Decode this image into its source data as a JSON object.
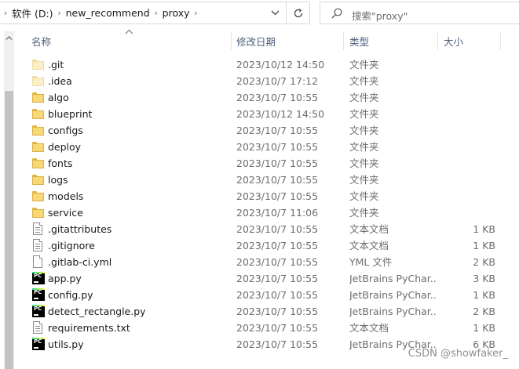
{
  "address_bar": {
    "breadcrumbs": [
      "软件 (D:)",
      "new_recommend",
      "proxy"
    ]
  },
  "search": {
    "placeholder": "搜索\"proxy\""
  },
  "columns": {
    "name": "名称",
    "date": "修改日期",
    "type": "类型",
    "size": "大小"
  },
  "files": [
    {
      "name": ".git",
      "date": "2023/10/12 14:50",
      "type": "文件夹",
      "size": "",
      "icon": "folder-faded-icon"
    },
    {
      "name": ".idea",
      "date": "2023/10/7 17:12",
      "type": "文件夹",
      "size": "",
      "icon": "folder-faded-icon"
    },
    {
      "name": "algo",
      "date": "2023/10/7 10:55",
      "type": "文件夹",
      "size": "",
      "icon": "folder-icon"
    },
    {
      "name": "blueprint",
      "date": "2023/10/12 14:50",
      "type": "文件夹",
      "size": "",
      "icon": "folder-icon"
    },
    {
      "name": "configs",
      "date": "2023/10/7 10:55",
      "type": "文件夹",
      "size": "",
      "icon": "folder-icon"
    },
    {
      "name": "deploy",
      "date": "2023/10/7 10:55",
      "type": "文件夹",
      "size": "",
      "icon": "folder-icon"
    },
    {
      "name": "fonts",
      "date": "2023/10/7 10:55",
      "type": "文件夹",
      "size": "",
      "icon": "folder-icon"
    },
    {
      "name": "logs",
      "date": "2023/10/7 10:55",
      "type": "文件夹",
      "size": "",
      "icon": "folder-icon"
    },
    {
      "name": "models",
      "date": "2023/10/7 10:55",
      "type": "文件夹",
      "size": "",
      "icon": "folder-icon"
    },
    {
      "name": "service",
      "date": "2023/10/7 11:06",
      "type": "文件夹",
      "size": "",
      "icon": "folder-icon"
    },
    {
      "name": ".gitattributes",
      "date": "2023/10/7 10:55",
      "type": "文本文档",
      "size": "1 KB",
      "icon": "text-file-icon"
    },
    {
      "name": ".gitignore",
      "date": "2023/10/7 10:55",
      "type": "文本文档",
      "size": "1 KB",
      "icon": "text-file-icon"
    },
    {
      "name": ".gitlab-ci.yml",
      "date": "2023/10/7 10:55",
      "type": "YML 文件",
      "size": "2 KB",
      "icon": "blank-file-icon"
    },
    {
      "name": "app.py",
      "date": "2023/10/7 10:55",
      "type": "JetBrains PyChar...",
      "size": "3 KB",
      "icon": "pycharm-file-icon"
    },
    {
      "name": "config.py",
      "date": "2023/10/7 10:55",
      "type": "JetBrains PyChar...",
      "size": "1 KB",
      "icon": "pycharm-file-icon"
    },
    {
      "name": "detect_rectangle.py",
      "date": "2023/10/7 10:55",
      "type": "JetBrains PyChar...",
      "size": "2 KB",
      "icon": "pycharm-file-icon"
    },
    {
      "name": "requirements.txt",
      "date": "2023/10/7 10:55",
      "type": "文本文档",
      "size": "1 KB",
      "icon": "text-file-icon"
    },
    {
      "name": "utils.py",
      "date": "2023/10/7 10:55",
      "type": "JetBrains PyChar...",
      "size": "6 KB",
      "icon": "pycharm-file-icon"
    }
  ],
  "watermark": "CSDN @showfaker_"
}
